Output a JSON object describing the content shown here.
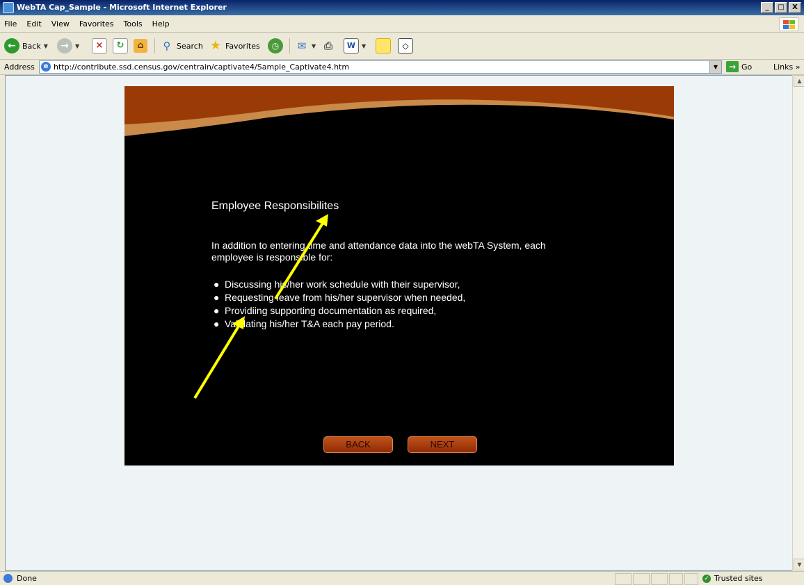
{
  "window": {
    "title": "WebTA Cap_Sample - Microsoft Internet Explorer",
    "controls": [
      "_",
      "□",
      "X"
    ]
  },
  "menu": {
    "items": [
      "File",
      "Edit",
      "View",
      "Favorites",
      "Tools",
      "Help"
    ]
  },
  "toolbar": {
    "back_label": "Back",
    "search_label": "Search",
    "favorites_label": "Favorites"
  },
  "address": {
    "label": "Address",
    "url": "http://contribute.ssd.census.gov/centrain/captivate4/Sample_Captivate4.htm",
    "go_label": "Go",
    "links_label": "Links"
  },
  "slide": {
    "title": "Employee Responsibilites",
    "intro": "In addition to entering time and attendance data into the webTA System, each employee is responsible for:",
    "bullets": [
      "Discussing his/her work schedule with their supervisor,",
      "Requesting leave from his/her supervisor when needed,",
      "Providiing supporting documentation as required,",
      "Validating his/her T&A each pay period."
    ],
    "back_label": "BACK",
    "next_label": "NEXT",
    "colors": {
      "background": "#000000",
      "header_wave": "#9a3b07",
      "wave_band": "#c98a4a",
      "button": "#a8410f",
      "annotation_arrow": "#ffff00"
    }
  },
  "status": {
    "text": "Done",
    "zone": "Trusted sites"
  }
}
